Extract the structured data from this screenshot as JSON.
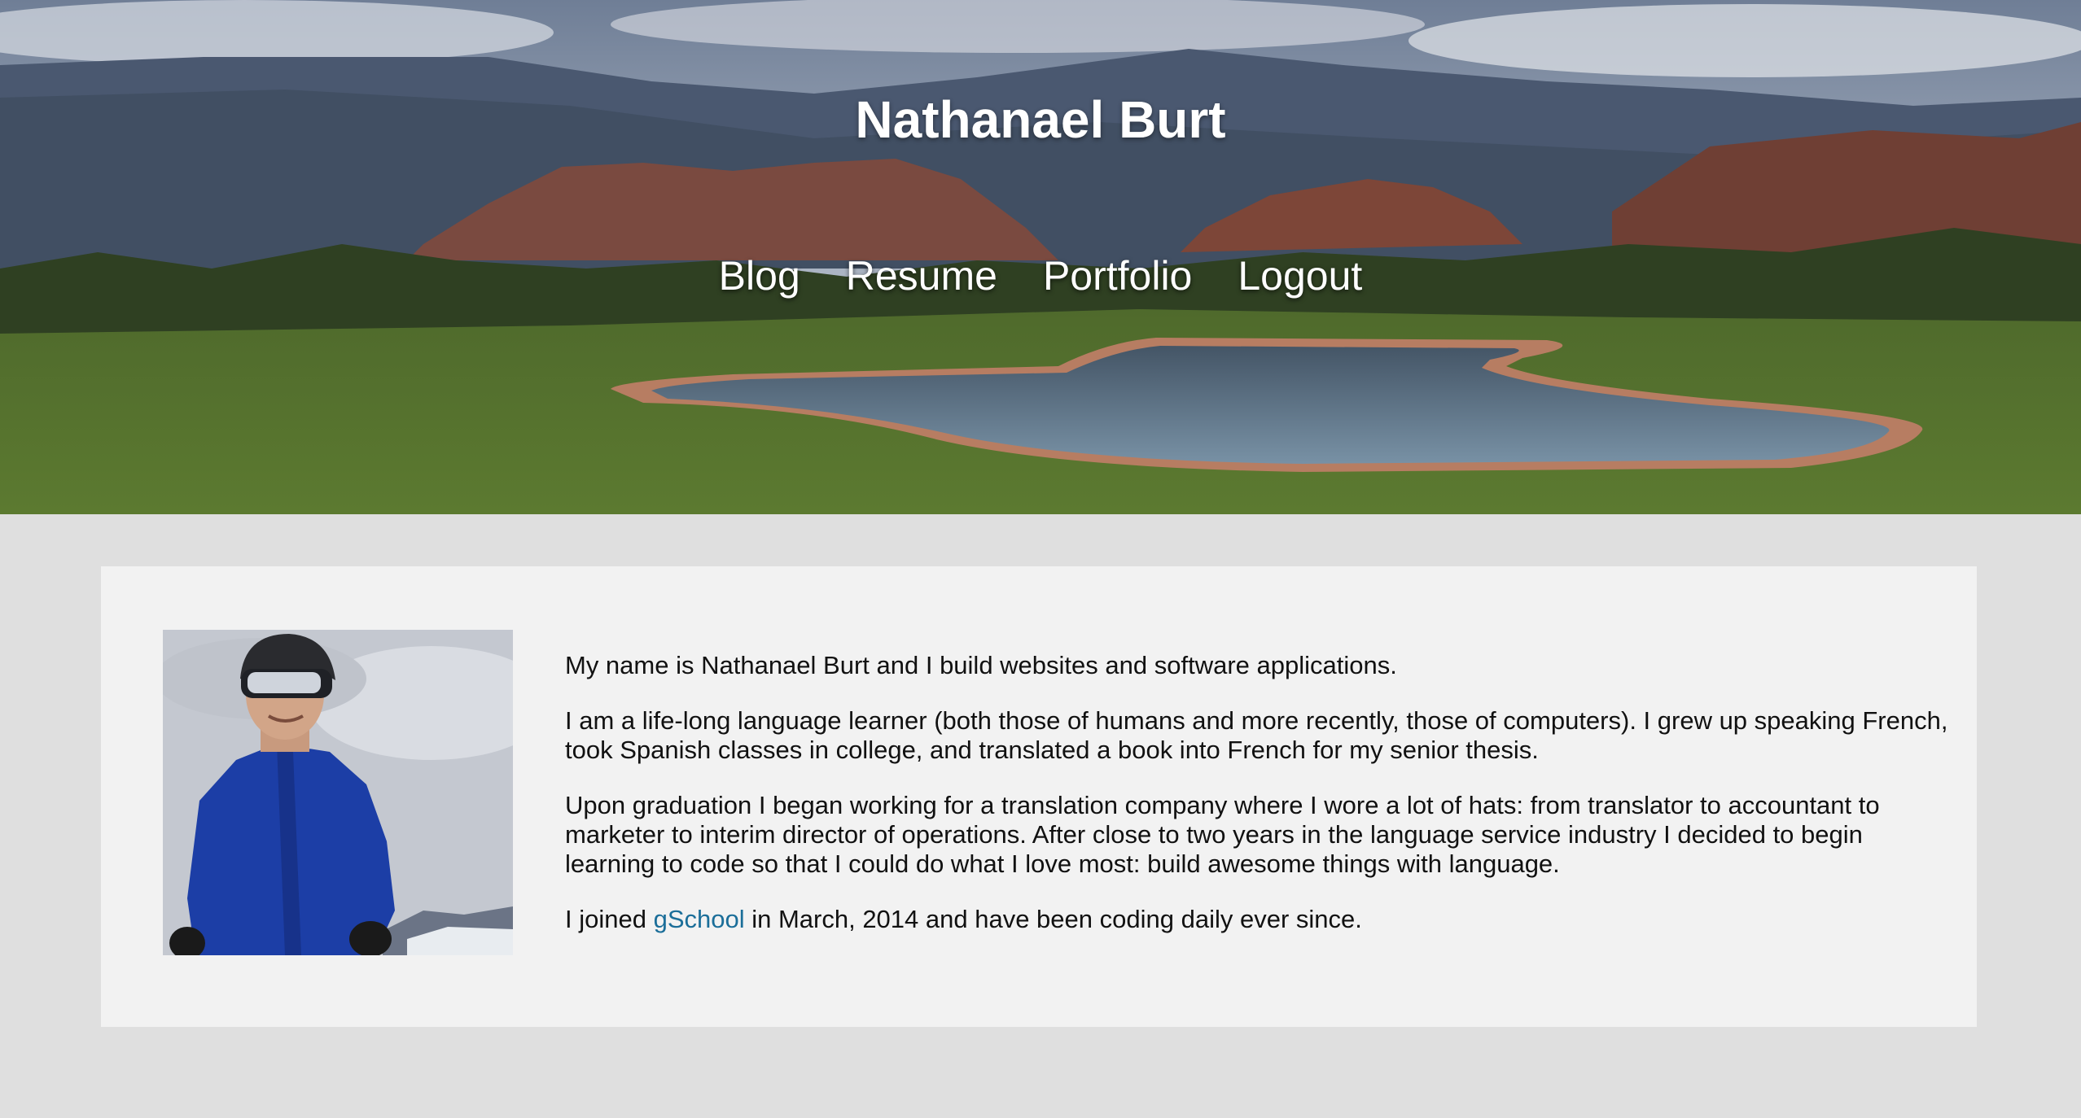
{
  "header": {
    "title": "Nathanael Burt",
    "nav": [
      {
        "label": "Blog"
      },
      {
        "label": "Resume"
      },
      {
        "label": "Portfolio"
      },
      {
        "label": "Logout"
      }
    ]
  },
  "about": {
    "paragraphs": [
      "My name is Nathanael Burt and I build websites and software applications.",
      "I am a life-long language learner (both those of humans and more recently, those of computers). I grew up speaking French, took Spanish classes in college, and translated a book into French for my senior thesis.",
      "Upon graduation I began working for a translation company where I wore a lot of hats: from translator to accountant to marketer to interim director of operations. After close to two years in the language service industry I decided to begin learning to code so that I could do what I love most: build awesome things with language."
    ],
    "last_paragraph": {
      "before": "I joined ",
      "link": "gSchool",
      "after": " in March, 2014 and have been coding daily ever since."
    }
  },
  "colors": {
    "page_background": "#dfdfdf",
    "card_background": "#f2f2f2",
    "link": "#1b6e99",
    "header_text": "#ffffff"
  }
}
